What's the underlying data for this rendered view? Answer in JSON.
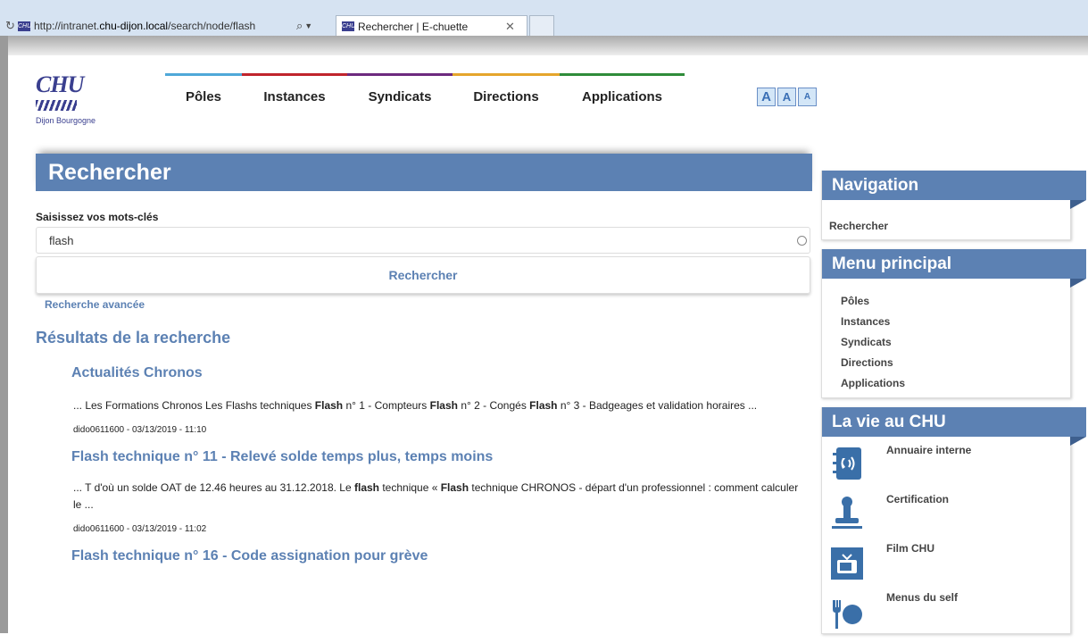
{
  "browser": {
    "url_plain": "http://intranet.",
    "url_bold": "chu-dijon.local",
    "url_rest": "/search/node/flash",
    "tab_title": "Rechercher | E-chuette",
    "favicon_text": "CHU"
  },
  "logo": {
    "brand": "CHU",
    "city": "Dijon Bourgogne"
  },
  "nav": [
    {
      "label": "Pôles",
      "color": "#4fa8d8"
    },
    {
      "label": "Instances",
      "color": "#c0242c"
    },
    {
      "label": "Syndicats",
      "color": "#6d2a7e"
    },
    {
      "label": "Directions",
      "color": "#e5a52c"
    },
    {
      "label": "Applications",
      "color": "#2f8c3a"
    }
  ],
  "fontsize": [
    "A",
    "A",
    "A"
  ],
  "search": {
    "page_title": "Rechercher",
    "label": "Saisissez vos mots-clés",
    "value": "flash",
    "button": "Rechercher",
    "advanced": "Recherche avancée",
    "results_title": "Résultats de la recherche"
  },
  "results": [
    {
      "title": "Actualités Chronos",
      "snippet_html": "... Les Formations Chronos Les Flashs techniques <b>Flash</b> n° 1 - Compteurs <b>Flash</b> n° 2 - Congés <b>Flash</b> n° 3 - Badgeages et validation horaires ...",
      "meta": "dido0611600 - 03/13/2019 - 11:10"
    },
    {
      "title": "Flash technique n° 11 - Relevé solde temps plus, temps moins",
      "snippet_html": "... T d'où un solde OAT de 12.46 heures au 31.12.2018. Le <b>flash</b> technique « <b>Flash</b> technique CHRONOS - départ d'un professionnel : comment calculer le ...",
      "meta": "dido0611600 - 03/13/2019 - 11:02"
    },
    {
      "title": "Flash technique n° 16 - Code assignation pour grève",
      "snippet_html": "",
      "meta": ""
    }
  ],
  "sidebar": {
    "navigation": {
      "title": "Navigation",
      "links": [
        "Rechercher"
      ]
    },
    "menu": {
      "title": "Menu principal",
      "links": [
        "Pôles",
        "Instances",
        "Syndicats",
        "Directions",
        "Applications"
      ]
    },
    "vie": {
      "title": "La vie au CHU",
      "items": [
        "Annuaire interne",
        "Certification",
        "Film CHU",
        "Menus du self"
      ]
    }
  },
  "colors": {
    "accent": "#5c81b3",
    "accent_dark": "#3e5f8e"
  }
}
